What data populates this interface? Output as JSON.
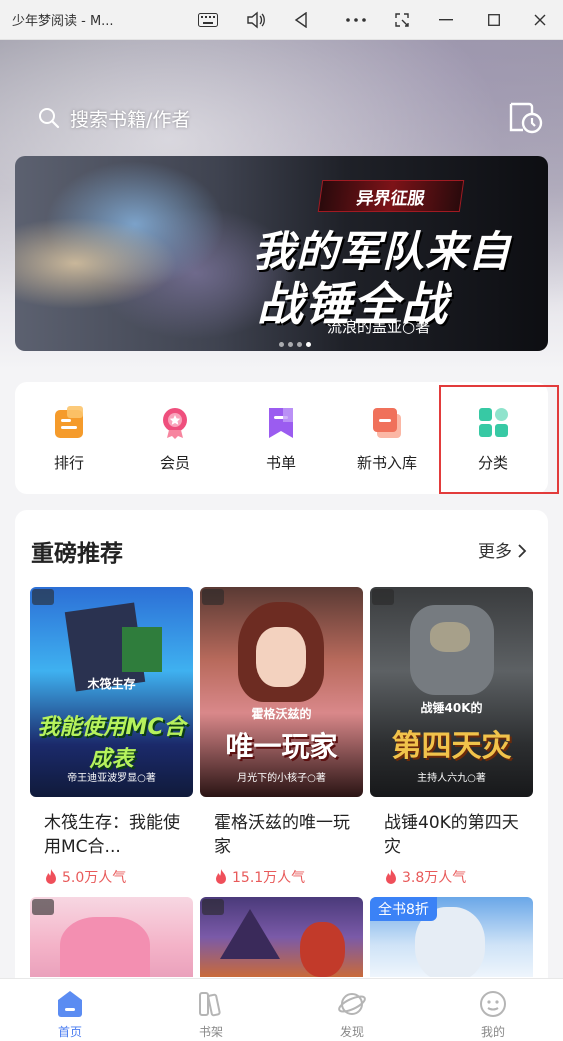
{
  "window": {
    "title": "少年梦阅读 - M..."
  },
  "search": {
    "placeholder": "搜索书籍/作者"
  },
  "banner": {
    "tag": "异界征服",
    "title_line1": "我的军队来自",
    "title_line2": "战锤全战",
    "author": "流浪的盖亚○著"
  },
  "quick_nav": [
    {
      "label": "排行",
      "icon": "ranking-icon",
      "color": "#f59b2b"
    },
    {
      "label": "会员",
      "icon": "vip-icon",
      "color": "#ef4f7d"
    },
    {
      "label": "书单",
      "icon": "booklist-icon",
      "color": "#9b5cf0"
    },
    {
      "label": "新书入库",
      "icon": "newbook-icon",
      "color": "#f0715b"
    },
    {
      "label": "分类",
      "icon": "category-icon",
      "color": "#37c9a4"
    }
  ],
  "recommend": {
    "title": "重磅推荐",
    "more": "更多",
    "books": [
      {
        "name": "木筏生存：我能使用MC合...",
        "popularity": "5.0万人气",
        "cover_text": "我能使用MC合成表",
        "cover_small": "木筏生存",
        "cover_author": "帝王迪亚波罗显○著"
      },
      {
        "name": "霍格沃兹的唯一玩家",
        "popularity": "15.1万人气",
        "cover_text": "唯一玩家",
        "cover_small": "霍格沃兹的",
        "cover_author": "月光下的小核子○著"
      },
      {
        "name": "战锤40K的第四天灾",
        "popularity": "3.8万人气",
        "cover_text": "第四天灾",
        "cover_small": "战锤40K的",
        "cover_author": "主持人六九○著"
      }
    ],
    "row2_badge": "全书8折"
  },
  "bottom_nav": [
    {
      "label": "首页",
      "active": true
    },
    {
      "label": "书架",
      "active": false
    },
    {
      "label": "发现",
      "active": false
    },
    {
      "label": "我的",
      "active": false
    }
  ]
}
